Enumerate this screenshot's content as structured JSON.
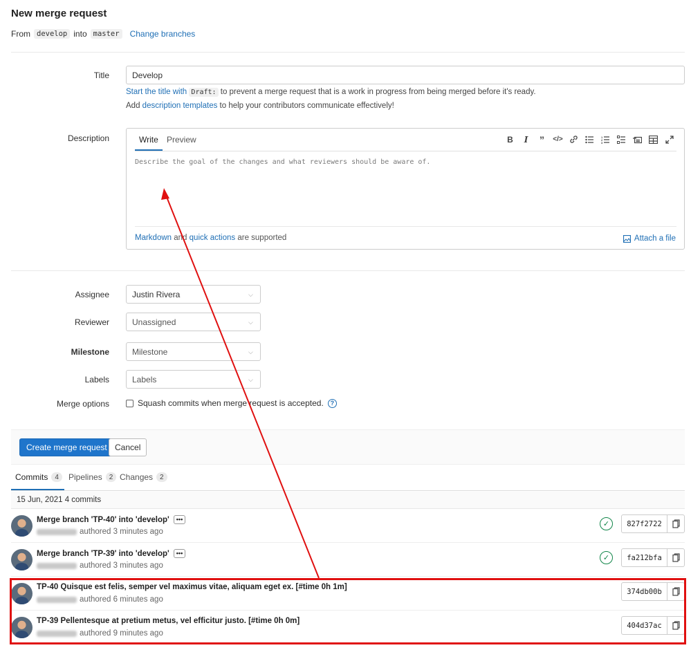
{
  "header": {
    "title": "New merge request",
    "from_label": "From",
    "source_branch": "develop",
    "into_label": "into",
    "target_branch": "master",
    "change_branches": "Change branches"
  },
  "form": {
    "title_label": "Title",
    "title_value": "Develop",
    "hint1_link": "Start the title with",
    "hint1_chip": "Draft:",
    "hint1_rest": "to prevent a merge request that is a work in progress from being merged before it's ready.",
    "hint2_pre": "Add",
    "hint2_link": "description templates",
    "hint2_rest": "to help your contributors communicate effectively!",
    "description_label": "Description",
    "tab_write": "Write",
    "tab_preview": "Preview",
    "placeholder": "Describe the goal of the changes and what reviewers should be aware of.",
    "markdown_link": "Markdown",
    "and_text": "and",
    "quick_actions_link": "quick actions",
    "supported_text": "are supported",
    "attach_file": "Attach a file",
    "assignee_label": "Assignee",
    "assignee_value": "Justin Rivera",
    "reviewer_label": "Reviewer",
    "reviewer_value": "Unassigned",
    "milestone_label": "Milestone",
    "milestone_value": "Milestone",
    "labels_label": "Labels",
    "labels_value": "Labels",
    "merge_options_label": "Merge options",
    "squash_text": "Squash commits when merge request is accepted."
  },
  "toolbar_icons": [
    "bold-icon",
    "italic-icon",
    "quote-icon",
    "code-icon",
    "link-icon",
    "bullet-list-icon",
    "numbered-list-icon",
    "task-list-icon",
    "collapsible-icon",
    "table-icon",
    "fullscreen-icon"
  ],
  "actions": {
    "create": "Create merge request",
    "cancel": "Cancel"
  },
  "tabs": [
    {
      "label": "Commits",
      "count": "4"
    },
    {
      "label": "Pipelines",
      "count": "2"
    },
    {
      "label": "Changes",
      "count": "2"
    }
  ],
  "day_header": "15 Jun, 2021 4 commits",
  "commits": [
    {
      "title": "Merge branch 'TP-40' into 'develop'",
      "meta": "authored 3 minutes ago",
      "sha": "827f2722",
      "has_status": true,
      "has_dots": true
    },
    {
      "title": "Merge branch 'TP-39' into 'develop'",
      "meta": "authored 3 minutes ago",
      "sha": "fa212bfa",
      "has_status": true,
      "has_dots": true
    },
    {
      "title": "TP-40 Quisque est felis, semper vel maximus vitae, aliquam eget ex. [#time 0h 1m]",
      "meta": "authored 6 minutes ago",
      "sha": "374db00b",
      "has_status": false,
      "has_dots": false
    },
    {
      "title": "TP-39 Pellentesque at pretium metus, vel efficitur justo. [#time 0h 0m]",
      "meta": "authored 9 minutes ago",
      "sha": "404d37ac",
      "has_status": false,
      "has_dots": false
    }
  ],
  "colors": {
    "accent": "#1f75cb",
    "annotation_red": "#e01010",
    "success": "#108548"
  }
}
